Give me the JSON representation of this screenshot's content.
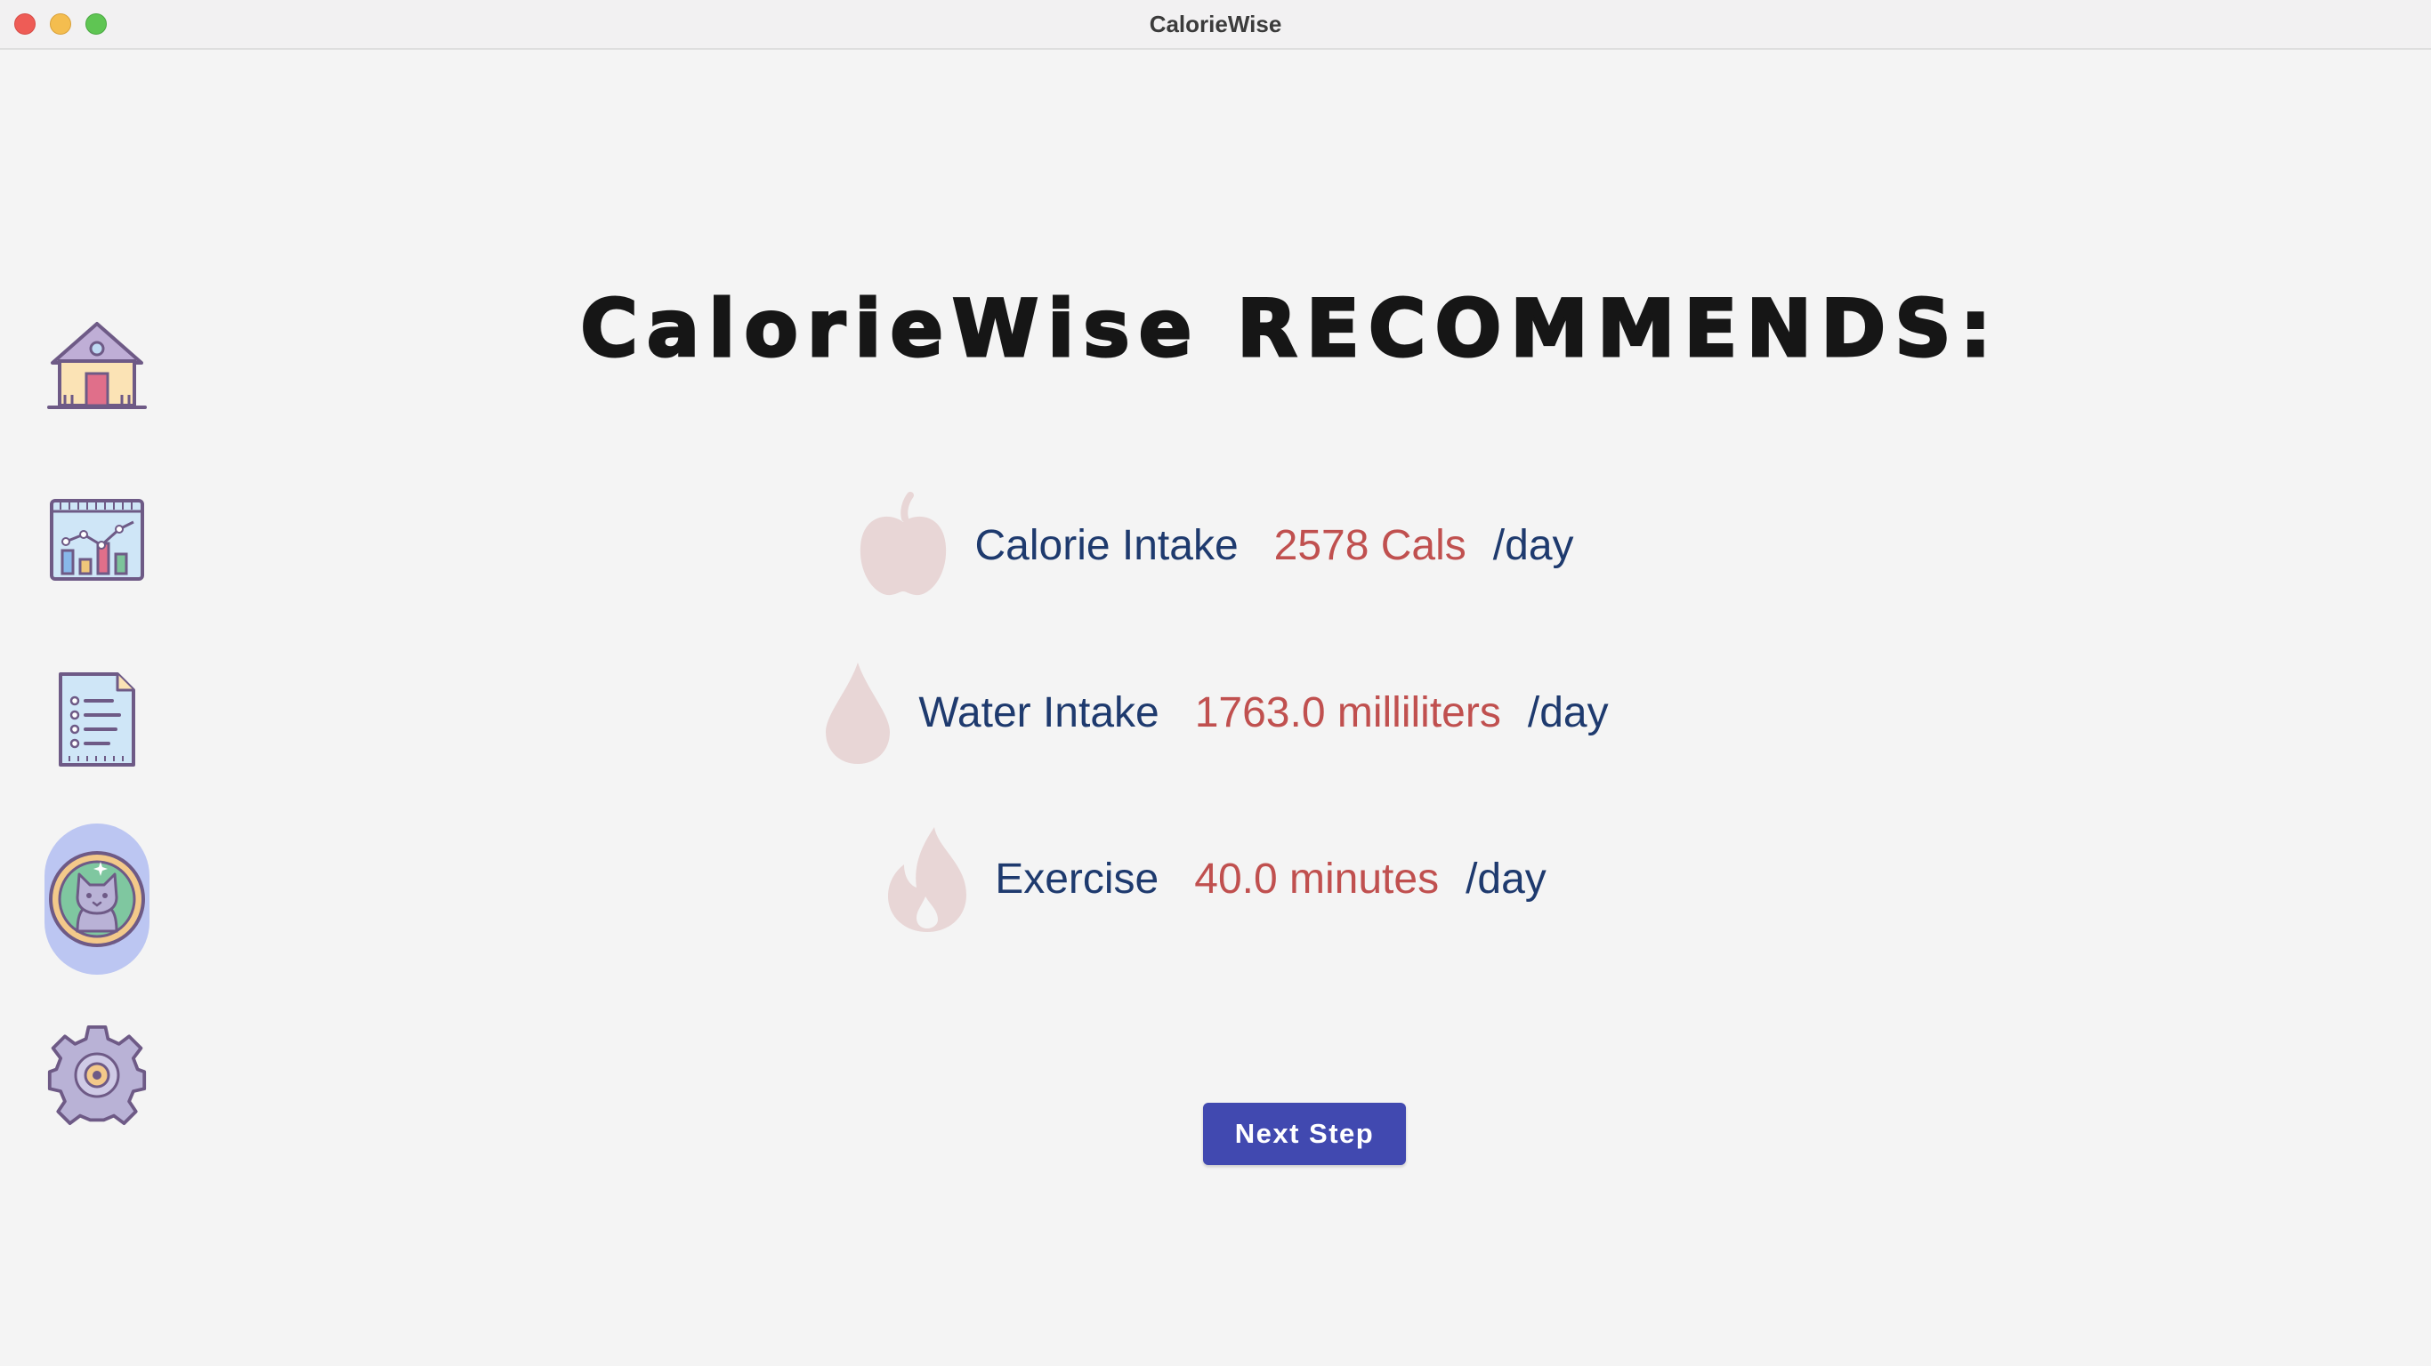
{
  "window": {
    "title": "CalorieWise"
  },
  "sidebar": {
    "items": [
      {
        "name": "home",
        "icon": "house-icon",
        "active": false
      },
      {
        "name": "statistics",
        "icon": "chart-icon",
        "active": false
      },
      {
        "name": "log",
        "icon": "document-list-icon",
        "active": false
      },
      {
        "name": "profile",
        "icon": "cat-avatar-icon",
        "active": true
      },
      {
        "name": "settings",
        "icon": "gear-icon",
        "active": false
      }
    ],
    "active_color": "#bcc6f2"
  },
  "main": {
    "headline": "CalorieWise RECOMMENDS:",
    "recommendations": [
      {
        "icon": "apple-icon",
        "label": "Calorie Intake",
        "value": "2578 Cals",
        "unit": "/day"
      },
      {
        "icon": "water-drop-icon",
        "label": "Water Intake",
        "value": "1763.0 milliliters",
        "unit": "/day"
      },
      {
        "icon": "flame-icon",
        "label": "Exercise",
        "value": "40.0 minutes",
        "unit": "/day"
      }
    ],
    "next_button_label": "Next Step"
  },
  "colors": {
    "label": "#1e3a6e",
    "value": "#c0504f",
    "button": "#4149b0",
    "icon_faded": "#e8d6d6"
  }
}
